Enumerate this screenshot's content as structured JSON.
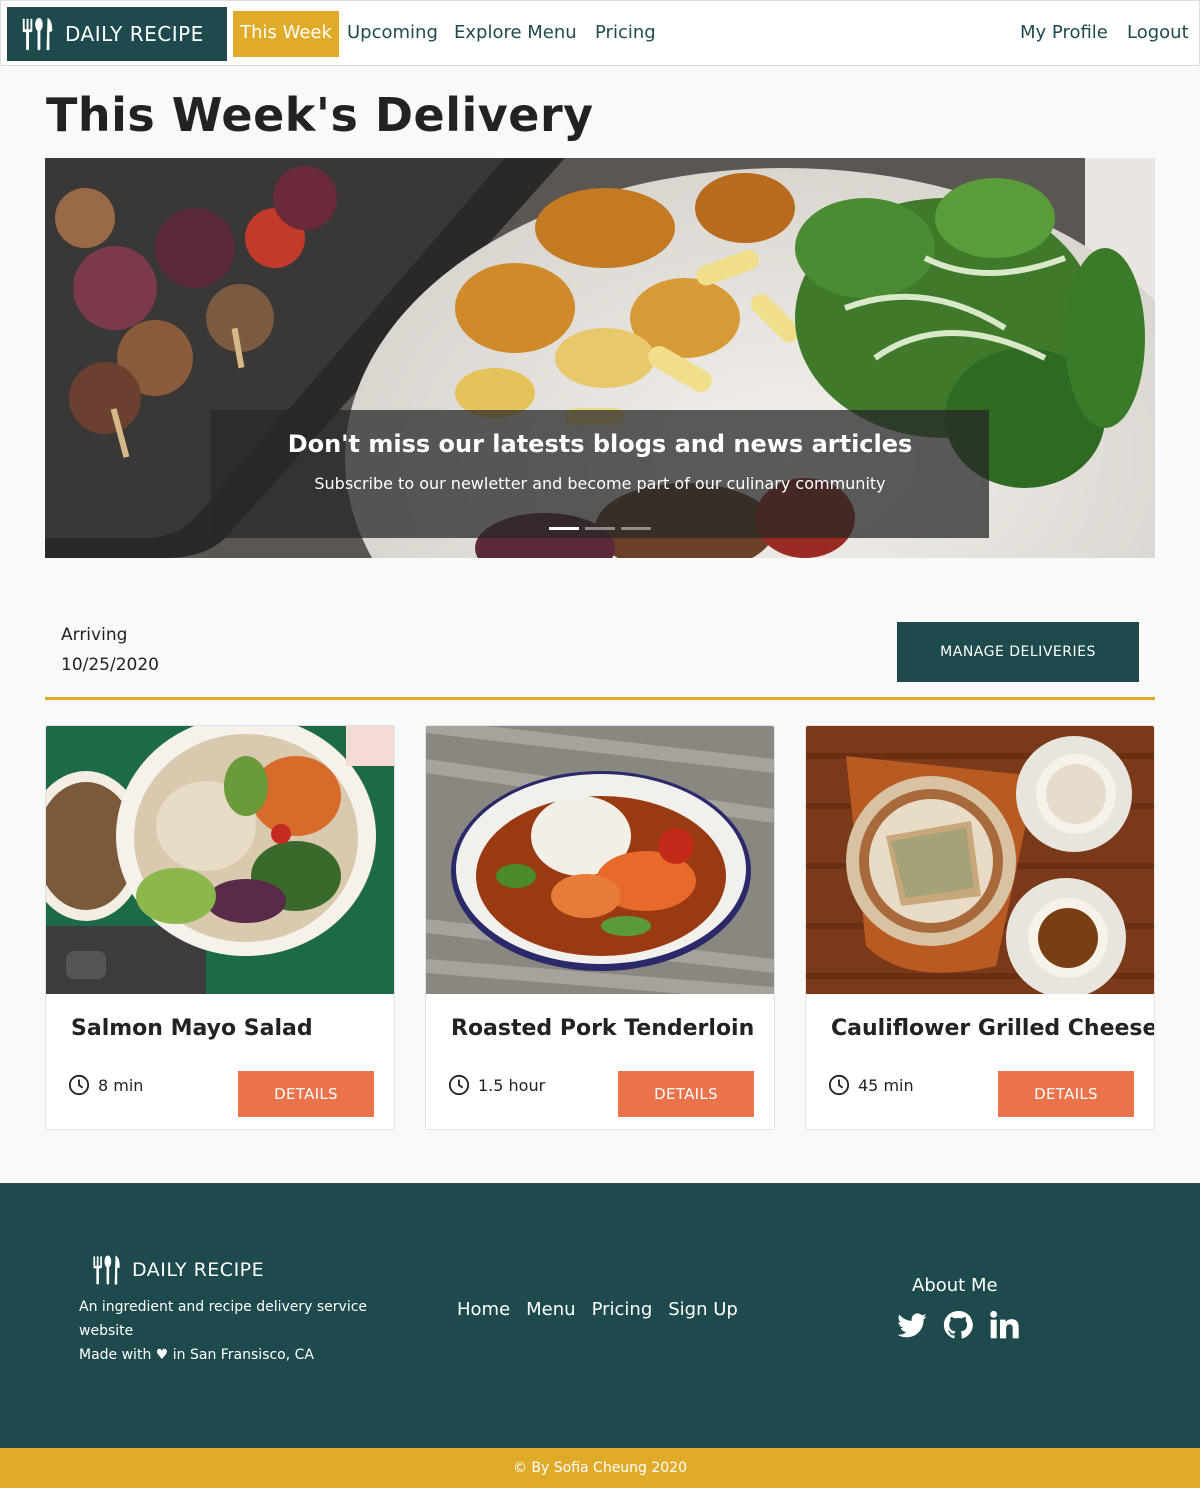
{
  "navbar": {
    "brand": "DAILY RECIPE",
    "links": [
      "This Week",
      "Upcoming",
      "Explore Menu",
      "Pricing"
    ],
    "right_links": [
      "My Profile",
      "Logout"
    ],
    "active": "This Week"
  },
  "page": {
    "title": "This Week's Delivery"
  },
  "hero": {
    "caption_title": "Don't miss our latests blogs and news articles",
    "caption_subtitle": "Subscribe to our newletter and become part of our culinary community",
    "slide_count": 3,
    "active_slide": 1
  },
  "delivery": {
    "arriving_label": "Arriving",
    "arriving_date": "10/25/2020",
    "manage_button": "MANAGE DELIVERIES"
  },
  "recipes": [
    {
      "title": "Salmon Mayo Salad",
      "time": "8 min",
      "button": "DETAILS"
    },
    {
      "title": "Roasted Pork Tenderloin",
      "time": "1.5 hour",
      "button": "DETAILS"
    },
    {
      "title": "Cauliflower Grilled Cheese",
      "time": "45 min",
      "button": "DETAILS"
    }
  ],
  "footer": {
    "brand": "DAILY RECIPE",
    "description": "An ingredient and recipe delivery service website",
    "made_with": "Made with ♥ in San Fransisco, CA",
    "links": [
      "Home",
      "Menu",
      "Pricing",
      "Sign Up"
    ],
    "about_label": "About Me",
    "social_icons": [
      "twitter-icon",
      "github-icon",
      "linkedin-icon"
    ],
    "copyright": "© By Sofia Cheung 2020"
  },
  "colors": {
    "primary": "#1e4a4e",
    "accent": "#e0ab29",
    "button": "#ea734b",
    "background": "#f9f9f9"
  }
}
